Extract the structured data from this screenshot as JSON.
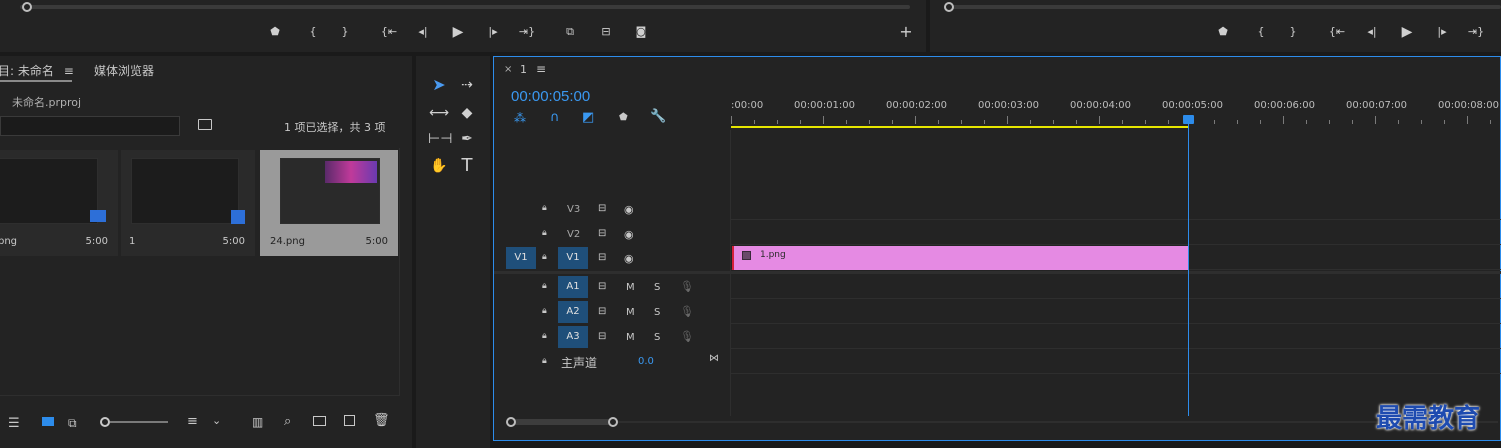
{
  "project": {
    "tab_active": "目: 未命名",
    "tab_menu_icon": "hamburger-icon",
    "tab_media_browser": "媒体浏览器",
    "project_file": "未命名.prproj",
    "selection_status": "1 项已选择，共 3 项",
    "items": [
      {
        "name": "png",
        "duration": "5:00",
        "selected": false
      },
      {
        "name": "1",
        "duration": "5:00",
        "selected": false
      },
      {
        "name": "24.png",
        "duration": "5:00",
        "selected": true
      }
    ]
  },
  "timeline": {
    "close_icon": "×",
    "sequence_name": "1",
    "timecode": "00:00:05:00",
    "ruler": [
      ":00:00",
      "00:00:01:00",
      "00:00:02:00",
      "00:00:03:00",
      "00:00:04:00",
      "00:00:05:00",
      "00:00:06:00",
      "00:00:07:00",
      "00:00:08:00"
    ],
    "video_tracks": [
      {
        "label": "V3",
        "source": "",
        "active": false
      },
      {
        "label": "V2",
        "source": "",
        "active": false
      },
      {
        "label": "V1",
        "source": "V1",
        "active": true
      }
    ],
    "audio_tracks": [
      {
        "label": "A1",
        "m": "M",
        "s": "S"
      },
      {
        "label": "A2",
        "m": "M",
        "s": "S"
      },
      {
        "label": "A3",
        "m": "M",
        "s": "S"
      }
    ],
    "master": {
      "label": "主声道",
      "value": "0.0"
    },
    "clip": {
      "name": "1.png",
      "color": "#e58ae3"
    },
    "playhead_color": "#2d8ceb",
    "work_area_color": "#e6e600"
  },
  "watermark": "最需教育"
}
